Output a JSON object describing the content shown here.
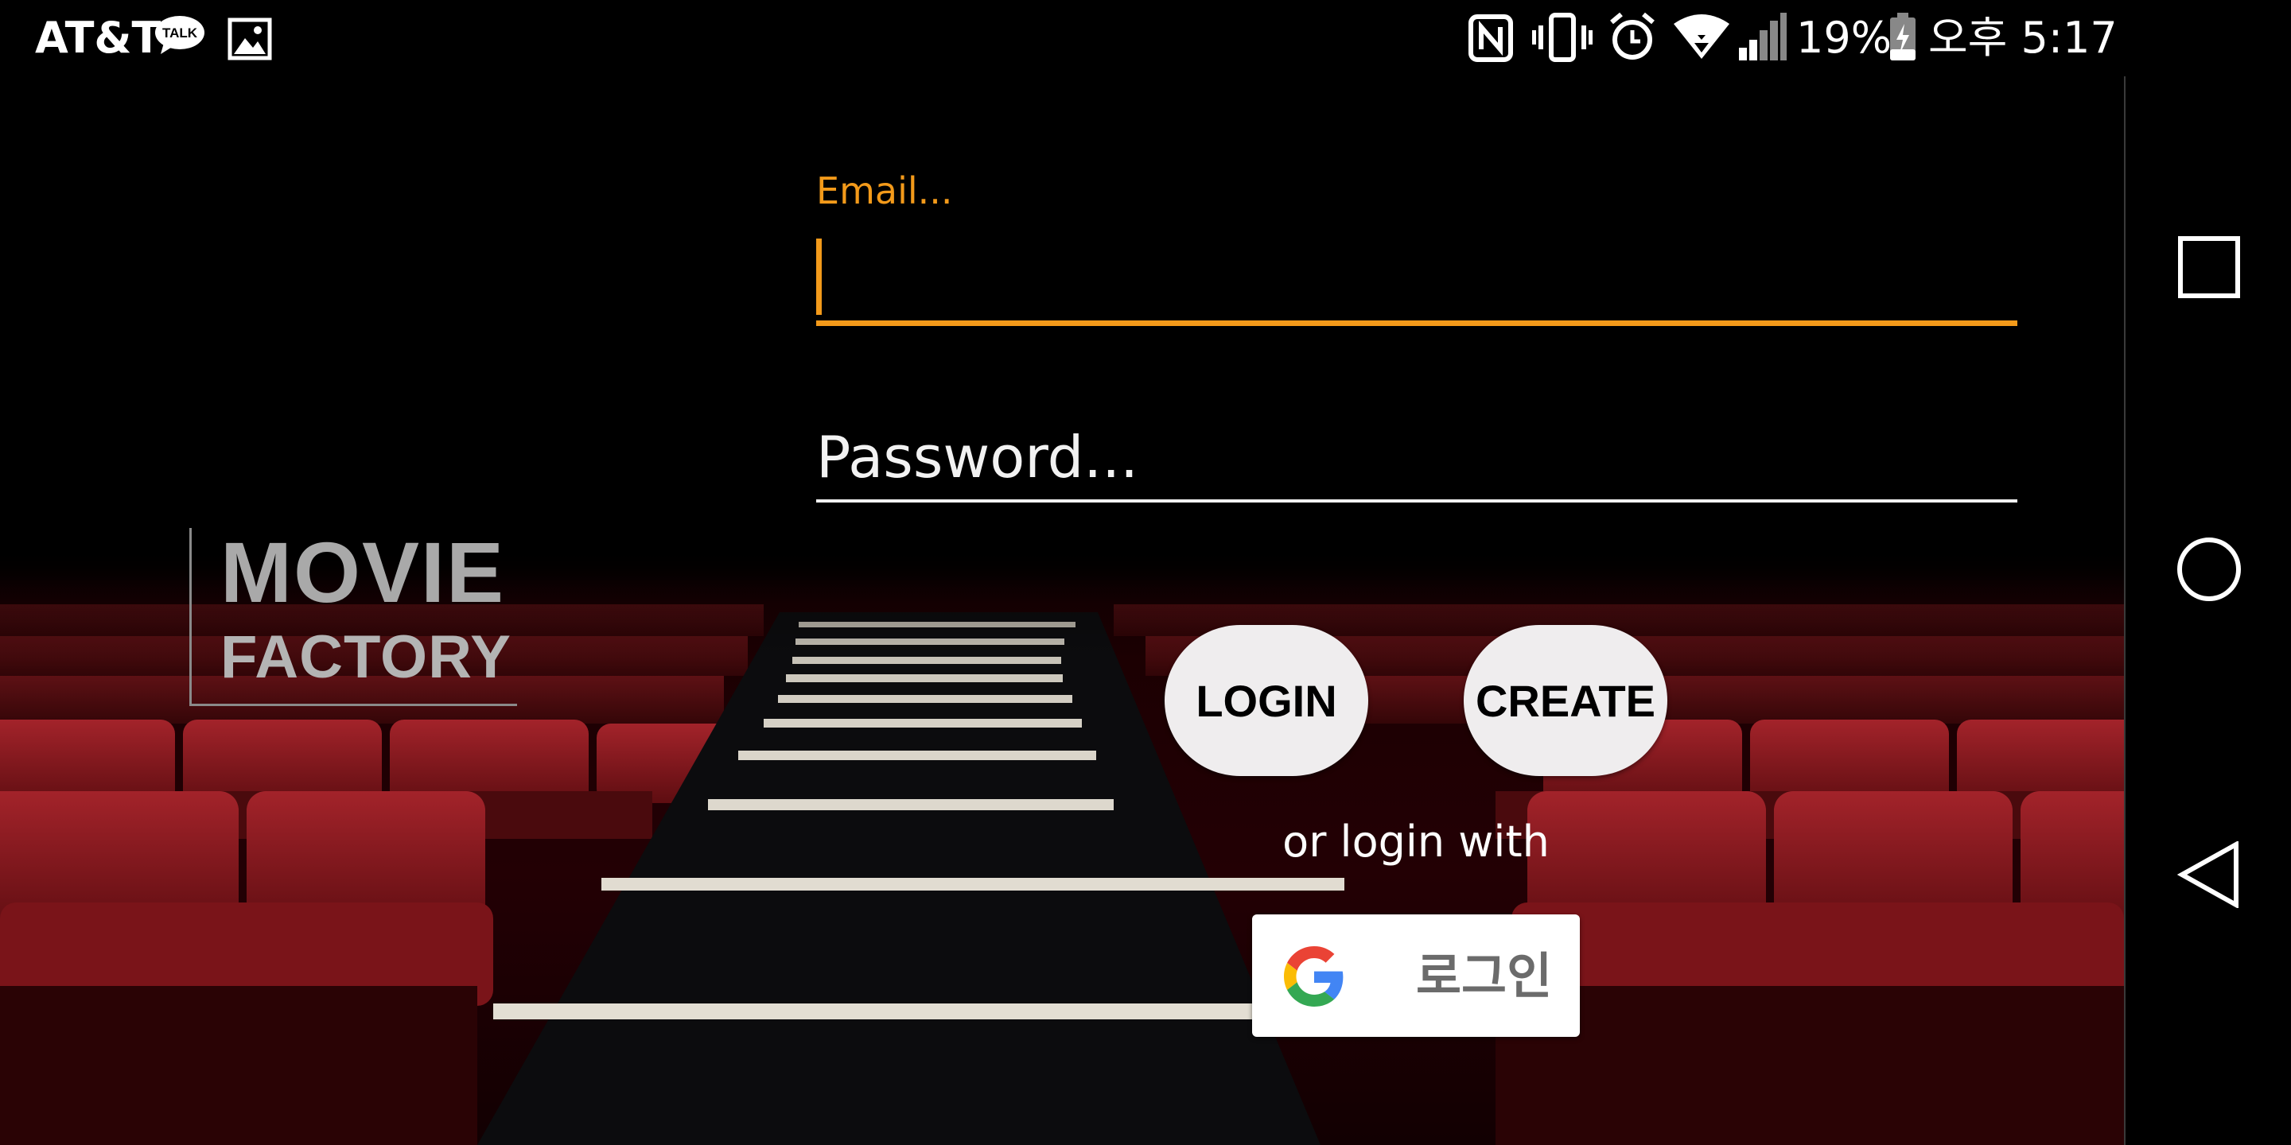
{
  "status_bar": {
    "carrier": "AT&T",
    "talk_badge": "TALK",
    "battery_percent": "19%",
    "clock": "오후 5:17",
    "icons": [
      "kakaotalk-icon",
      "gallery-icon",
      "nfc-icon",
      "vibrate-icon",
      "alarm-icon",
      "wifi-icon",
      "signal-icon",
      "battery-icon"
    ]
  },
  "app": {
    "logo_line1": "MOVIE",
    "logo_line2": "FACTORY"
  },
  "form": {
    "email_label": "Email...",
    "email_value": "",
    "password_placeholder": "Password...",
    "login_label": "LOGIN",
    "create_label": "CREATE",
    "or_text": "or login with",
    "google_label": "로그인"
  },
  "navigation": {
    "icons": [
      "recents-icon",
      "home-icon",
      "back-icon"
    ]
  },
  "colors": {
    "accent": "#f39a1a",
    "button_bg": "#efedee",
    "seat_red": "#8b1a1f"
  }
}
